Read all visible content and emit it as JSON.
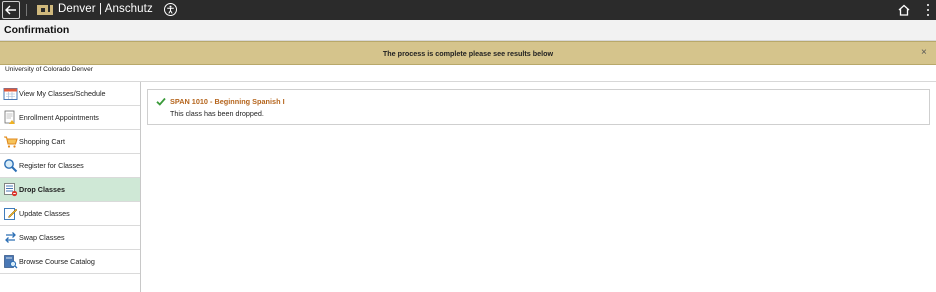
{
  "header": {
    "brand": "Denver | Anschutz",
    "back_icon": "back-arrow-icon",
    "logo_icon": "cu-logo-icon",
    "accessibility_icon": "accessibility-icon",
    "home_icon": "home-icon",
    "menu_icon": "kebab-menu-icon"
  },
  "page": {
    "title": "Confirmation",
    "institution": "University of Colorado Denver"
  },
  "message": {
    "text": "The process is complete please see results below",
    "close_symbol": "×"
  },
  "sidebar": {
    "items": [
      {
        "label": "View My Classes/Schedule",
        "icon": "calendar-icon",
        "active": false
      },
      {
        "label": "Enrollment Appointments",
        "icon": "document-clock-icon",
        "active": false
      },
      {
        "label": "Shopping Cart",
        "icon": "cart-icon",
        "active": false
      },
      {
        "label": "Register for Classes",
        "icon": "search-icon",
        "active": false
      },
      {
        "label": "Drop Classes",
        "icon": "drop-list-icon",
        "active": true
      },
      {
        "label": "Update Classes",
        "icon": "edit-icon",
        "active": false
      },
      {
        "label": "Swap Classes",
        "icon": "swap-arrows-icon",
        "active": false
      },
      {
        "label": "Browse Course Catalog",
        "icon": "catalog-icon",
        "active": false
      }
    ]
  },
  "result": {
    "status_icon": "checkmark-icon",
    "course": "SPAN 1010 - Beginning Spanish I",
    "message": "This class has been dropped."
  },
  "colors": {
    "topbar": "#2b2b2b",
    "message_bar": "#d5c48c",
    "active_nav": "#cfe8d6",
    "course_title": "#b5651d",
    "check": "#3a9a3a"
  }
}
